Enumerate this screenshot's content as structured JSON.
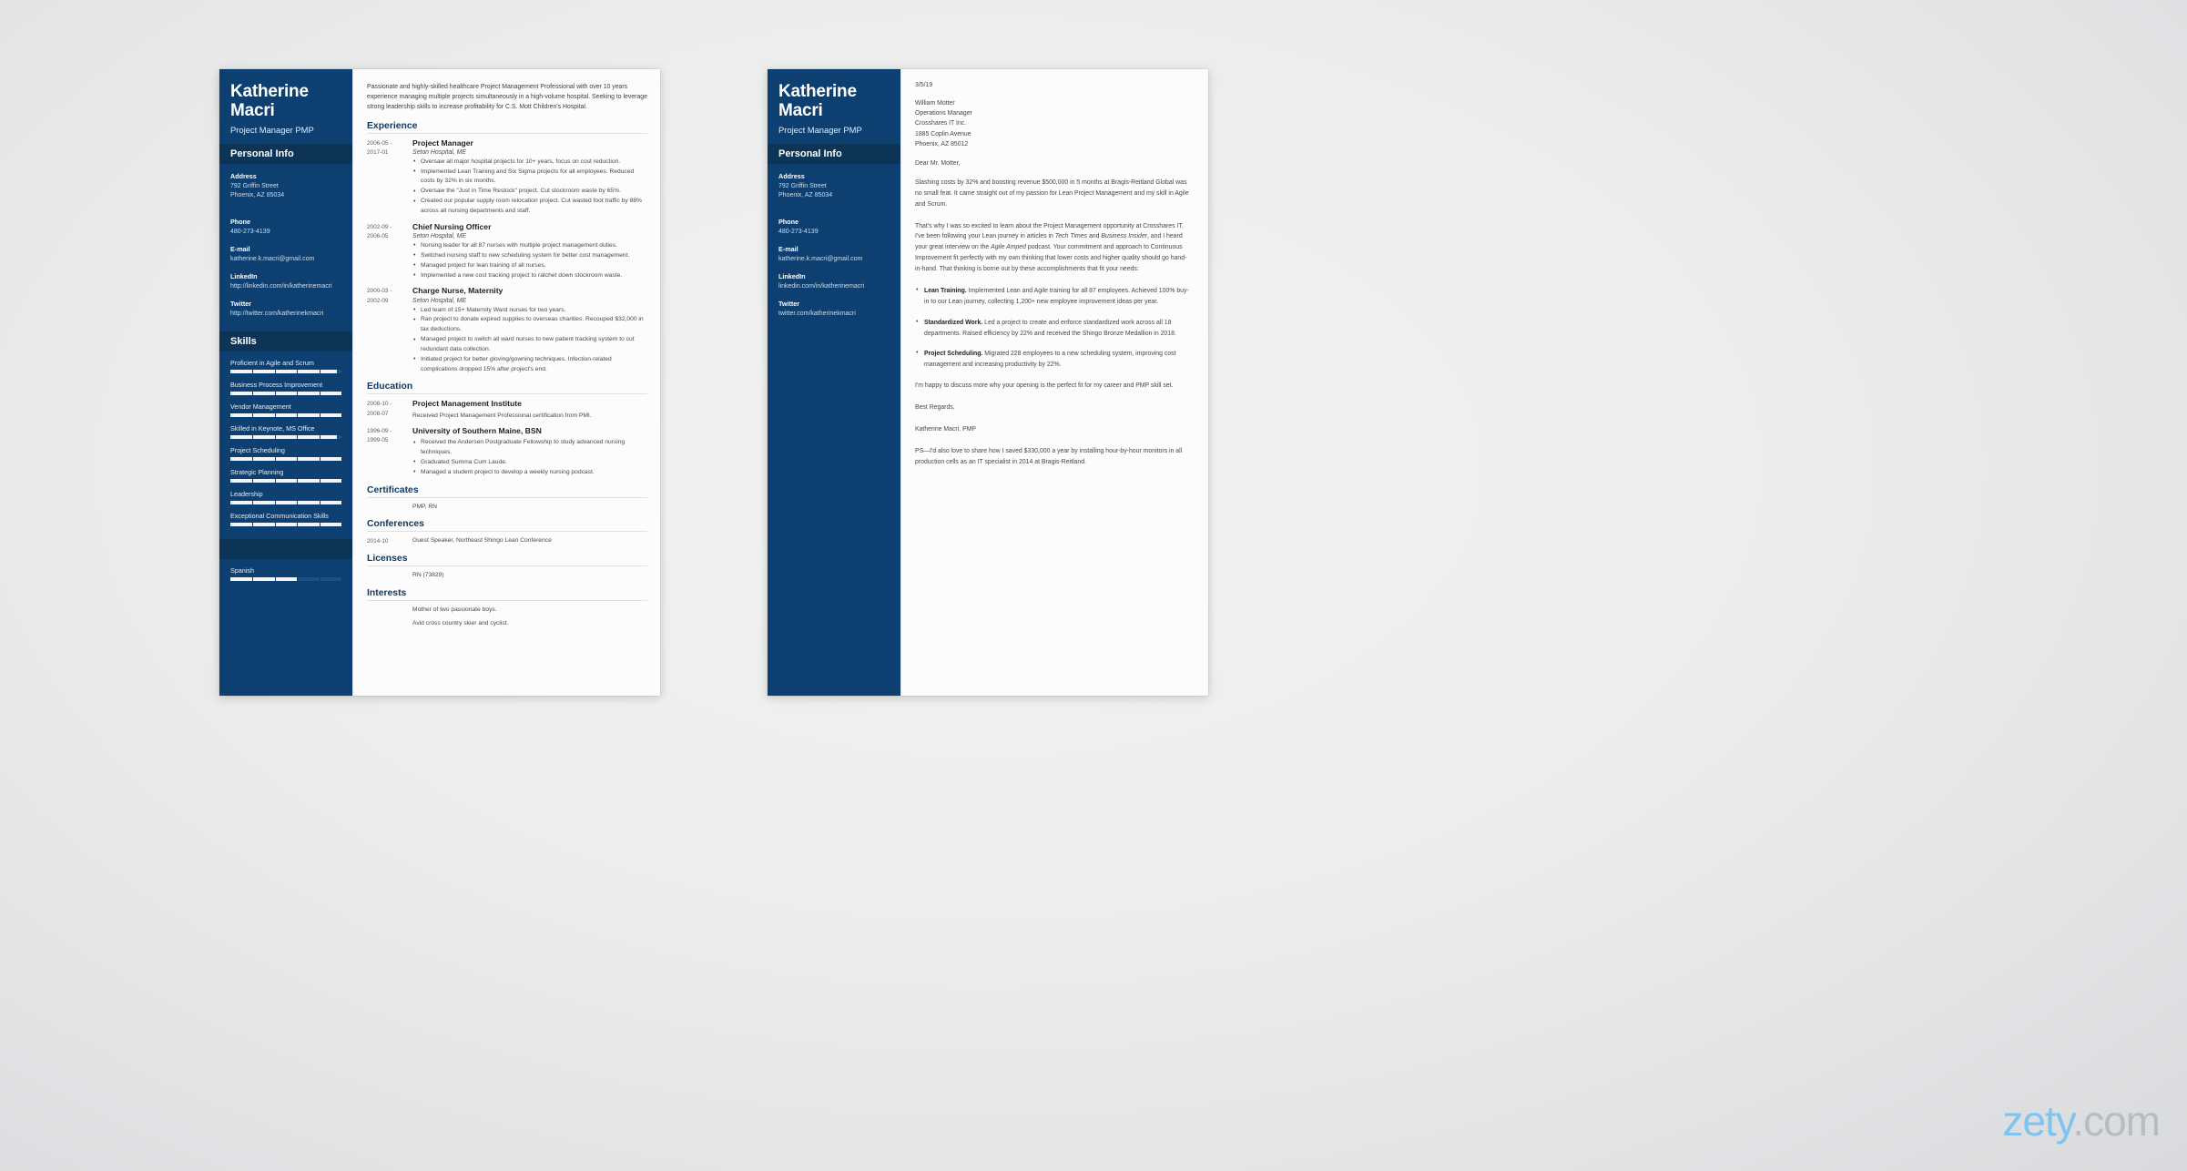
{
  "watermark": {
    "brand": "zety",
    "tld": ".com"
  },
  "candidate": {
    "first_name": "Katherine",
    "last_name": "Macri",
    "full_name": "Katherine Macri",
    "job_title": "Project Manager PMP"
  },
  "sidebar": {
    "personal_info_title": "Personal Info",
    "skills_title": "Skills",
    "languages_title": "",
    "fields": [
      {
        "label": "Address",
        "value_line1": "792 Griffin Street",
        "value_line2": "Phoenix, AZ 85034"
      },
      {
        "label": "Phone",
        "value_line1": "480-273-4139",
        "value_line2": ""
      },
      {
        "label": "E-mail",
        "value_line1": "katherine.k.macri@gmail.com",
        "value_line2": ""
      },
      {
        "label": "LinkedIn",
        "value_line1": "http://linkedin.com/in/katherinemacri",
        "value_line2": ""
      },
      {
        "label": "Twitter",
        "value_line1": "http://twitter.com/katherinekmacri",
        "value_line2": ""
      }
    ],
    "fields_page2": [
      {
        "label": "Address",
        "value_line1": "792 Griffin Street",
        "value_line2": "Phoenix, AZ 85034"
      },
      {
        "label": "Phone",
        "value_line1": "480-273-4139",
        "value_line2": ""
      },
      {
        "label": "E-mail",
        "value_line1": "katherine.k.macri@gmail.com",
        "value_line2": ""
      },
      {
        "label": "LinkedIn",
        "value_line1": "linkedin.com/in/katherinemacri",
        "value_line2": ""
      },
      {
        "label": "Twitter",
        "value_line1": "twitter.com/katherinekmacri",
        "value_line2": ""
      }
    ],
    "skills": [
      {
        "name": "Proficient in Agile and Scrum",
        "level": 96
      },
      {
        "name": "Business Process Improvement",
        "level": 100
      },
      {
        "name": "Vendor Management",
        "level": 100
      },
      {
        "name": "Skilled in Keynote, MS Office",
        "level": 96
      },
      {
        "name": "Project Scheduling",
        "level": 100
      },
      {
        "name": "Strategic Planning",
        "level": 100
      },
      {
        "name": "Leadership",
        "level": 100
      },
      {
        "name": "Exceptional Communication Skills",
        "level": 100
      }
    ],
    "languages": [
      {
        "name": "Spanish",
        "level": 60
      }
    ]
  },
  "resume": {
    "summary": "Passionate and highly-skilled healthcare Project Management Professional with over 10 years experience managing multiple projects simultaneously in a high-volume hospital. Seeking to leverage strong leadership skills to increase profitability for C.S. Mott Children's Hospital.",
    "sections": {
      "experience": "Experience",
      "education": "Education",
      "certificates": "Certificates",
      "conferences": "Conferences",
      "licenses": "Licenses",
      "interests": "Interests"
    },
    "experience": [
      {
        "date_from": "2006-05 -",
        "date_to": "2017-01",
        "role": "Project Manager",
        "org": "Seton Hospital, ME",
        "bullets": [
          "Oversaw all major hospital projects for 10+ years, focus on cost reduction.",
          "Implemented Lean Training and Six Sigma projects for all employees. Reduced costs by 32% in six months.",
          "Oversaw the \"Just in Time Restock\" project. Cut stockroom waste by 65%.",
          "Created our popular supply room relocation project. Cut wasted foot traffic by 88% across all nursing departments and staff."
        ]
      },
      {
        "date_from": "2002-09 -",
        "date_to": "2006-05",
        "role": "Chief Nursing Officer",
        "org": "Seton Hospital, ME",
        "bullets": [
          "Nursing leader for all 87 nurses with multiple project management duties.",
          "Switched nursing staff to new scheduling system for better cost management.",
          "Managed project for lean training of all nurses.",
          "Implemented a new cost tracking project to ratchet down stockroom waste."
        ]
      },
      {
        "date_from": "2000-03 -",
        "date_to": "2002-09",
        "role": "Charge Nurse, Maternity",
        "org": "Seton Hospital, ME",
        "bullets": [
          "Led team of 15+ Maternity Ward nurses for two years.",
          "Ran project to donate expired supplies to overseas charities. Recouped $32,000 in tax deductions.",
          "Managed project to switch all ward nurses to new patient tracking system to cut redundant data collection.",
          "Initiated project for better gloving/gowning techniques. Infection-related complications dropped 15% after project's end."
        ]
      }
    ],
    "education": [
      {
        "date_from": "2008-10 -",
        "date_to": "2008-07",
        "role": "Project Management Institute",
        "plain": "Received Project Management Professional certification from PMI.",
        "bullets": []
      },
      {
        "date_from": "1996-09 -",
        "date_to": "1999-05",
        "role": "University of Southern Maine, BSN",
        "plain": "",
        "bullets": [
          "Received the Andersen Postgraduate Fellowship to study advanced nursing techniques.",
          "Graduated Summa Cum Laude.",
          "Managed a student project to develop a weekly nursing podcast."
        ]
      }
    ],
    "certificates": [
      {
        "date": "",
        "text": "PMP, RN"
      }
    ],
    "conferences": [
      {
        "date": "2014-10",
        "text": "Guest Speaker, Northeast Shingo Lean Conference"
      }
    ],
    "licenses": [
      {
        "date": "",
        "text": "RN (73829)"
      }
    ],
    "interests": [
      {
        "date": "",
        "text": "Mother of two passionate boys."
      },
      {
        "date": "",
        "text": "Avid cross country skier and cyclist."
      }
    ]
  },
  "cover_letter": {
    "date": "3/5/19",
    "recipient": {
      "name": "William Motter",
      "job_title": "Operations Manager",
      "company": "Crosshares IT Inc.",
      "street": "1885 Coplin Avenue",
      "city_state_zip": "Phoenix, AZ 85012"
    },
    "salutation": "Dear Mr. Motter,",
    "paragraph_1": "Slashing costs by 32% and boosting revenue $500,000 in 5 months at Bragis-Reitland Global was no small feat. It came straight out of my passion for Lean Project Management and my skill in Agile and Scrum.",
    "paragraph_2_part1": "That's why I was so excited to learn about the Project Management opportunity at Crosshares IT. I've been following your Lean journey in articles in ",
    "paragraph_2_em1": "Tech Times",
    "paragraph_2_part2": " and ",
    "paragraph_2_em2": "Business Insider",
    "paragraph_2_part3": ", and I heard your great interview on the ",
    "paragraph_2_em3": "Agile Amped",
    "paragraph_2_part4": " podcast. Your commitment and approach to Continuous Improvement fit perfectly with my own thinking that lower costs and higher quality should go hand-in-hand. That thinking is borne out by these accomplishments that fit your needs:",
    "bullets": [
      {
        "lead": "Lean Training.",
        "text": " Implemented Lean and Agile training for all 87 employees. Achieved 100% buy-in to our Lean journey, collecting 1,200+ new employee improvement ideas per year."
      },
      {
        "lead": "Standardized Work.",
        "text": " Led a project to create and enforce standardized work across all 18 departments. Raised efficiency by 22% and received the Shingo Bronze Medallion in 2018."
      },
      {
        "lead": "Project Scheduling.",
        "text": " Migrated 228 employees to a new scheduling system, improving cost management and increasing productivity by 22%."
      }
    ],
    "closing_line": "I'm happy to discuss more why your opening is the perfect fit for my career and PMP skill set.",
    "sign_off": "Best Regards,",
    "signature": "Katherine Macri, PMP",
    "postscript": "PS—I'd also love to share how I saved $330,000 a year by installing hour-by-hour monitors in all production cells as an IT specialist in 2014 at Bragis-Reitland."
  },
  "colors": {
    "sidebar_bg": "#0d4071",
    "sidebar_band": "#0b3457",
    "heading": "#123a61",
    "paper": "#fcfcfc"
  }
}
